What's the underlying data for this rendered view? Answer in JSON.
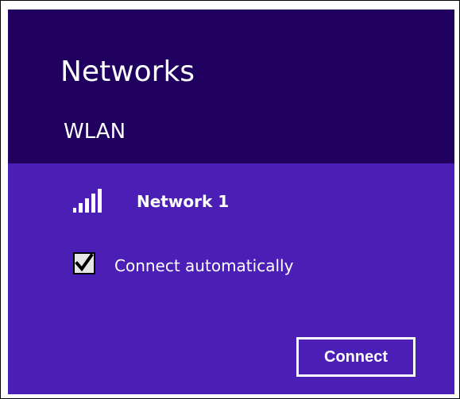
{
  "panel": {
    "title": "Networks",
    "section_label": "WLAN",
    "network": {
      "name": "Network 1",
      "signal_icon": "signal-bars-icon",
      "signal_strength": "full"
    },
    "auto_connect": {
      "label": "Connect automatically",
      "checked": true
    },
    "connect_button": {
      "label": "Connect"
    }
  },
  "colors": {
    "header_bg": "#1f005f",
    "network_area_bg": "#4b1fb5",
    "text": "#ffffff"
  }
}
